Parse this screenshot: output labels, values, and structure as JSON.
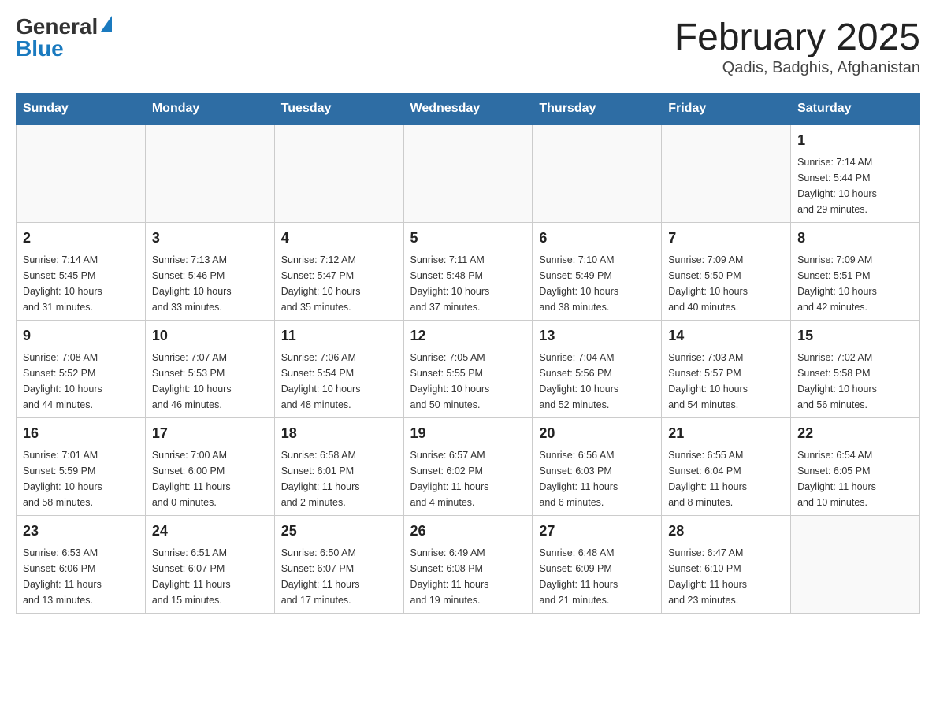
{
  "header": {
    "logo_general": "General",
    "logo_blue": "Blue",
    "month_title": "February 2025",
    "location": "Qadis, Badghis, Afghanistan"
  },
  "days_of_week": [
    "Sunday",
    "Monday",
    "Tuesday",
    "Wednesday",
    "Thursday",
    "Friday",
    "Saturday"
  ],
  "weeks": [
    {
      "days": [
        {
          "number": "",
          "info": ""
        },
        {
          "number": "",
          "info": ""
        },
        {
          "number": "",
          "info": ""
        },
        {
          "number": "",
          "info": ""
        },
        {
          "number": "",
          "info": ""
        },
        {
          "number": "",
          "info": ""
        },
        {
          "number": "1",
          "info": "Sunrise: 7:14 AM\nSunset: 5:44 PM\nDaylight: 10 hours\nand 29 minutes."
        }
      ]
    },
    {
      "days": [
        {
          "number": "2",
          "info": "Sunrise: 7:14 AM\nSunset: 5:45 PM\nDaylight: 10 hours\nand 31 minutes."
        },
        {
          "number": "3",
          "info": "Sunrise: 7:13 AM\nSunset: 5:46 PM\nDaylight: 10 hours\nand 33 minutes."
        },
        {
          "number": "4",
          "info": "Sunrise: 7:12 AM\nSunset: 5:47 PM\nDaylight: 10 hours\nand 35 minutes."
        },
        {
          "number": "5",
          "info": "Sunrise: 7:11 AM\nSunset: 5:48 PM\nDaylight: 10 hours\nand 37 minutes."
        },
        {
          "number": "6",
          "info": "Sunrise: 7:10 AM\nSunset: 5:49 PM\nDaylight: 10 hours\nand 38 minutes."
        },
        {
          "number": "7",
          "info": "Sunrise: 7:09 AM\nSunset: 5:50 PM\nDaylight: 10 hours\nand 40 minutes."
        },
        {
          "number": "8",
          "info": "Sunrise: 7:09 AM\nSunset: 5:51 PM\nDaylight: 10 hours\nand 42 minutes."
        }
      ]
    },
    {
      "days": [
        {
          "number": "9",
          "info": "Sunrise: 7:08 AM\nSunset: 5:52 PM\nDaylight: 10 hours\nand 44 minutes."
        },
        {
          "number": "10",
          "info": "Sunrise: 7:07 AM\nSunset: 5:53 PM\nDaylight: 10 hours\nand 46 minutes."
        },
        {
          "number": "11",
          "info": "Sunrise: 7:06 AM\nSunset: 5:54 PM\nDaylight: 10 hours\nand 48 minutes."
        },
        {
          "number": "12",
          "info": "Sunrise: 7:05 AM\nSunset: 5:55 PM\nDaylight: 10 hours\nand 50 minutes."
        },
        {
          "number": "13",
          "info": "Sunrise: 7:04 AM\nSunset: 5:56 PM\nDaylight: 10 hours\nand 52 minutes."
        },
        {
          "number": "14",
          "info": "Sunrise: 7:03 AM\nSunset: 5:57 PM\nDaylight: 10 hours\nand 54 minutes."
        },
        {
          "number": "15",
          "info": "Sunrise: 7:02 AM\nSunset: 5:58 PM\nDaylight: 10 hours\nand 56 minutes."
        }
      ]
    },
    {
      "days": [
        {
          "number": "16",
          "info": "Sunrise: 7:01 AM\nSunset: 5:59 PM\nDaylight: 10 hours\nand 58 minutes."
        },
        {
          "number": "17",
          "info": "Sunrise: 7:00 AM\nSunset: 6:00 PM\nDaylight: 11 hours\nand 0 minutes."
        },
        {
          "number": "18",
          "info": "Sunrise: 6:58 AM\nSunset: 6:01 PM\nDaylight: 11 hours\nand 2 minutes."
        },
        {
          "number": "19",
          "info": "Sunrise: 6:57 AM\nSunset: 6:02 PM\nDaylight: 11 hours\nand 4 minutes."
        },
        {
          "number": "20",
          "info": "Sunrise: 6:56 AM\nSunset: 6:03 PM\nDaylight: 11 hours\nand 6 minutes."
        },
        {
          "number": "21",
          "info": "Sunrise: 6:55 AM\nSunset: 6:04 PM\nDaylight: 11 hours\nand 8 minutes."
        },
        {
          "number": "22",
          "info": "Sunrise: 6:54 AM\nSunset: 6:05 PM\nDaylight: 11 hours\nand 10 minutes."
        }
      ]
    },
    {
      "days": [
        {
          "number": "23",
          "info": "Sunrise: 6:53 AM\nSunset: 6:06 PM\nDaylight: 11 hours\nand 13 minutes."
        },
        {
          "number": "24",
          "info": "Sunrise: 6:51 AM\nSunset: 6:07 PM\nDaylight: 11 hours\nand 15 minutes."
        },
        {
          "number": "25",
          "info": "Sunrise: 6:50 AM\nSunset: 6:07 PM\nDaylight: 11 hours\nand 17 minutes."
        },
        {
          "number": "26",
          "info": "Sunrise: 6:49 AM\nSunset: 6:08 PM\nDaylight: 11 hours\nand 19 minutes."
        },
        {
          "number": "27",
          "info": "Sunrise: 6:48 AM\nSunset: 6:09 PM\nDaylight: 11 hours\nand 21 minutes."
        },
        {
          "number": "28",
          "info": "Sunrise: 6:47 AM\nSunset: 6:10 PM\nDaylight: 11 hours\nand 23 minutes."
        },
        {
          "number": "",
          "info": ""
        }
      ]
    }
  ]
}
